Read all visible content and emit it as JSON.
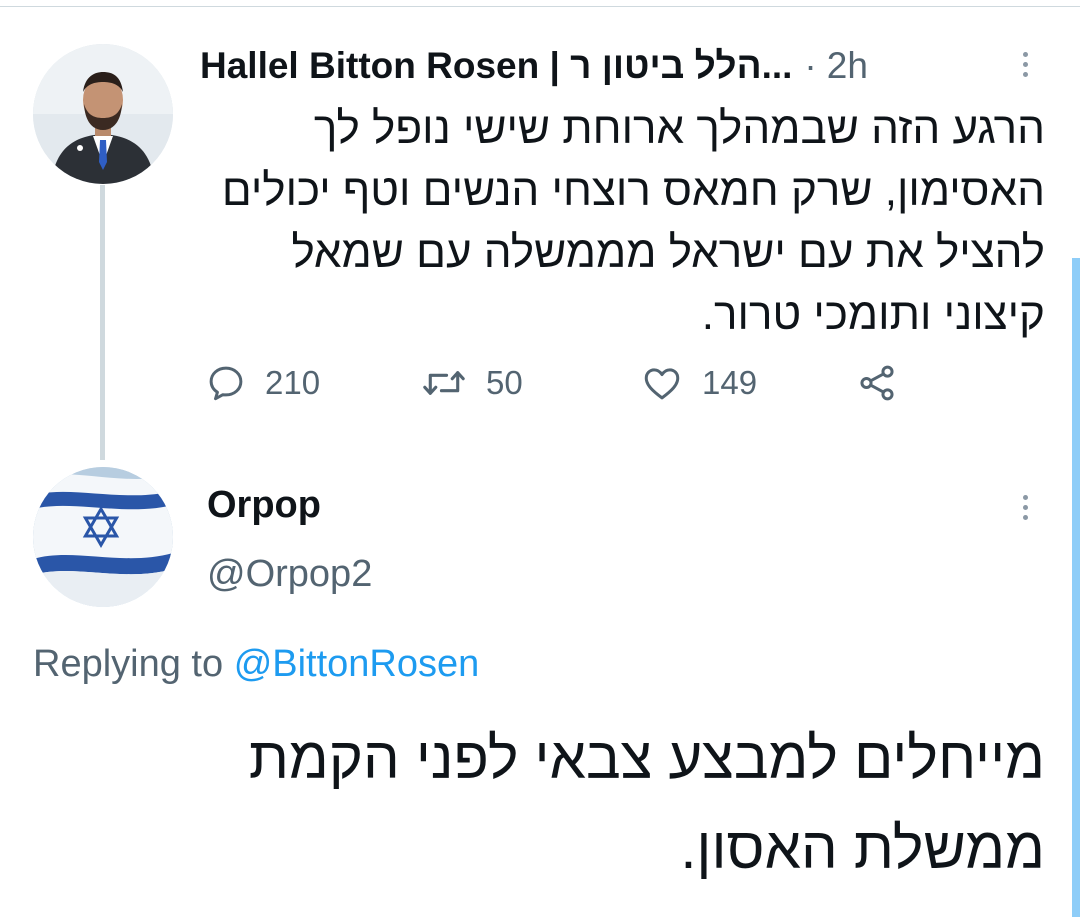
{
  "tweet": {
    "display_name": "Hallel Bitton Rosen | הלל ביטון ר...",
    "separator": "·",
    "time": "2h",
    "text": "הרגע הזה שבמהלך ארוחת שישי נופל לך האסימון, שרק חמאס רוצחי הנשים וטף יכולים להציל את עם ישראל מממשלה עם שמאל קיצוני ותומכי טרור.",
    "actions": {
      "reply_count": "210",
      "retweet_count": "50",
      "like_count": "149"
    }
  },
  "reply": {
    "display_name": "Orpop",
    "handle": "@Orpop2",
    "replying_prefix": "Replying to",
    "replying_to": "@BittonRosen",
    "text": "מייחלים למבצע צבאי לפני הקמת ממשלת האסון."
  },
  "icons": {
    "reply": "reply-bubble-icon",
    "retweet": "retweet-icon",
    "like": "heart-icon",
    "share": "share-icon",
    "more": "more-vertical-icon"
  },
  "colors": {
    "primary_text": "#0f1419",
    "secondary_text": "#536471",
    "accent": "#1d9bf0",
    "thread_line": "#cfd9de"
  }
}
